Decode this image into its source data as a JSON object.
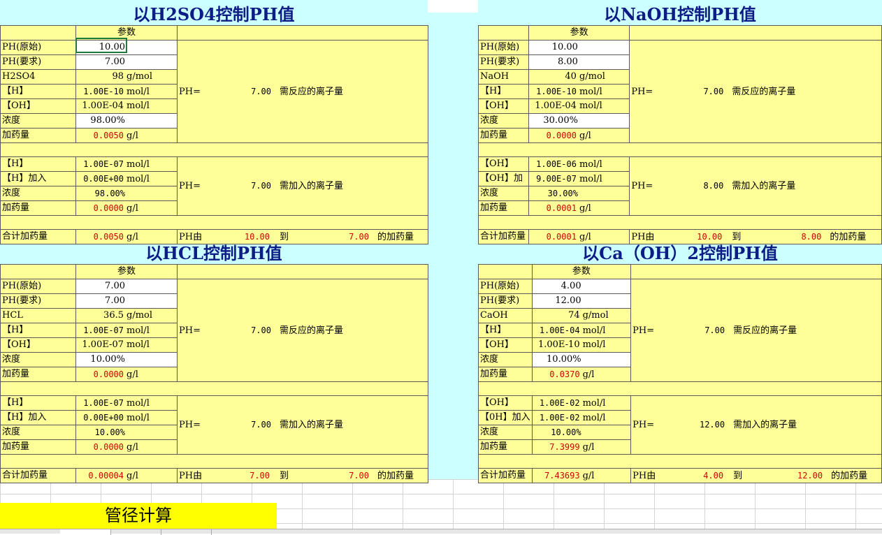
{
  "sections": [
    {
      "title": "以H2SO4控制PH值",
      "param_header": "参数",
      "rows": [
        {
          "label": "PH(原始)",
          "value": "10.00"
        },
        {
          "label": "PH(要求)",
          "value": "7.00"
        },
        {
          "label": "H2SO4",
          "value": "98",
          "unit": "g/mol"
        },
        {
          "label": "【H】",
          "value": "1.00E-10",
          "unit": "mol/l"
        },
        {
          "label": "【OH】",
          "value": "1.00E-04",
          "unit": "mol/l"
        },
        {
          "label": "浓度",
          "value": "98.00%"
        },
        {
          "label": "加药量",
          "value": "0.0050",
          "unit": "g/l"
        }
      ],
      "react": {
        "ph_label": "PH=",
        "ph_value": "7.00",
        "note": "需反应的离子量"
      },
      "rows2": [
        {
          "label": "【H】",
          "value": "1.00E-07",
          "unit": "mol/l"
        },
        {
          "label": "【H】加入",
          "value": "0.00E+00",
          "unit": "mol/l"
        },
        {
          "label": "浓度",
          "value": "98.00%"
        },
        {
          "label": "加药量",
          "value": "0.0000",
          "unit": "g/l"
        }
      ],
      "add": {
        "ph_label": "PH=",
        "ph_value": "7.00",
        "note": "需加入的离子量"
      },
      "total": {
        "label": "合计加药量",
        "value": "0.0050",
        "unit": "g/l",
        "from_label": "PH由",
        "from": "10.00",
        "to_label": "到",
        "to": "7.00",
        "suffix": "的加药量"
      }
    },
    {
      "title": "以NaOH控制PH值",
      "param_header": "参数",
      "rows": [
        {
          "label": "PH(原始)",
          "value": "10.00"
        },
        {
          "label": "PH(要求)",
          "value": "8.00"
        },
        {
          "label": "NaOH",
          "value": "40",
          "unit": "g/mol"
        },
        {
          "label": "【H】",
          "value": "1.00E-10",
          "unit": "mol/l"
        },
        {
          "label": "【OH】",
          "value": "1.00E-04",
          "unit": "mol/l"
        },
        {
          "label": "浓度",
          "value": "30.00%"
        },
        {
          "label": "加药量",
          "value": "0.0000",
          "unit": "g/l"
        }
      ],
      "react": {
        "ph_label": "PH=",
        "ph_value": "7.00",
        "note": "需反应的离子量"
      },
      "rows2": [
        {
          "label": "【OH】",
          "value": "1.00E-06",
          "unit": "mol/l"
        },
        {
          "label": "【OH】加",
          "value": "9.00E-07",
          "unit": "mol/l"
        },
        {
          "label": "浓度",
          "value": "30.00%"
        },
        {
          "label": "加药量",
          "value": "0.0001",
          "unit": "g/l"
        }
      ],
      "add": {
        "ph_label": "PH=",
        "ph_value": "8.00",
        "note": "需加入的离子量"
      },
      "total": {
        "label": "合计加药量",
        "value": "0.0001",
        "unit": "g/l",
        "from_label": "PH由",
        "from": "10.00",
        "to_label": "到",
        "to": "8.00",
        "suffix": "的加药量"
      }
    },
    {
      "title": "以HCL控制PH值",
      "param_header": "参数",
      "rows": [
        {
          "label": "PH(原始)",
          "value": "7.00"
        },
        {
          "label": "PH(要求)",
          "value": "7.00"
        },
        {
          "label": "HCL",
          "value": "36.5",
          "unit": "g/mol"
        },
        {
          "label": "【H】",
          "value": "1.00E-07",
          "unit": "mol/l"
        },
        {
          "label": "【OH】",
          "value": "1.00E-07",
          "unit": "mol/l"
        },
        {
          "label": "浓度",
          "value": "10.00%"
        },
        {
          "label": "加药量",
          "value": "0.0000",
          "unit": "g/l"
        }
      ],
      "react": {
        "ph_label": "PH=",
        "ph_value": "7.00",
        "note": "需反应的离子量"
      },
      "rows2": [
        {
          "label": "【H】",
          "value": "1.00E-07",
          "unit": "mol/l"
        },
        {
          "label": "【H】加入",
          "value": "0.00E+00",
          "unit": "mol/l"
        },
        {
          "label": "浓度",
          "value": "10.00%"
        },
        {
          "label": "加药量",
          "value": "0.0000",
          "unit": "g/l"
        }
      ],
      "add": {
        "ph_label": "PH=",
        "ph_value": "7.00",
        "note": "需加入的离子量"
      },
      "total": {
        "label": "合计加药量",
        "value": "0.00004",
        "unit": "g/l",
        "from_label": "PH由",
        "from": "7.00",
        "to_label": "到",
        "to": "7.00",
        "suffix": "的加药量"
      }
    },
    {
      "title": "以Ca（OH）2控制PH值",
      "param_header": "参数",
      "rows": [
        {
          "label": "PH(原始)",
          "value": "4.00"
        },
        {
          "label": "PH(要求)",
          "value": "12.00"
        },
        {
          "label": "CaOH",
          "value": "74",
          "unit": "g/mol"
        },
        {
          "label": "【H】",
          "value": "1.00E-04",
          "unit": "mol/l"
        },
        {
          "label": "【OH】",
          "value": "1.00E-10",
          "unit": "mol/l"
        },
        {
          "label": "浓度",
          "value": "10.00%"
        },
        {
          "label": "加药量",
          "value": "0.0370",
          "unit": "g/l"
        }
      ],
      "react": {
        "ph_label": "PH=",
        "ph_value": "7.00",
        "note": "需反应的离子量"
      },
      "rows2": [
        {
          "label": "【OH】",
          "value": "1.00E-02",
          "unit": "mol/l"
        },
        {
          "label": "【0H】加入",
          "value": "1.00E-02",
          "unit": "mol/l"
        },
        {
          "label": "浓度",
          "value": "10.00%"
        },
        {
          "label": "加药量",
          "value": "7.3999",
          "unit": "g/l"
        }
      ],
      "add": {
        "ph_label": "PH=",
        "ph_value": "12.00",
        "note": "需加入的离子量"
      },
      "total": {
        "label": "合计加药量",
        "value": "7.43693",
        "unit": "g/l",
        "from_label": "PH由",
        "from": "4.00",
        "to_label": "到",
        "to": "12.00",
        "suffix": "的加药量"
      }
    }
  ],
  "button": {
    "label": "管径计算"
  },
  "colors": {
    "title": "#0e1c86",
    "panel": "#ffff99",
    "background": "#ccffff",
    "button": "#ffff00",
    "result": "#d00000"
  }
}
